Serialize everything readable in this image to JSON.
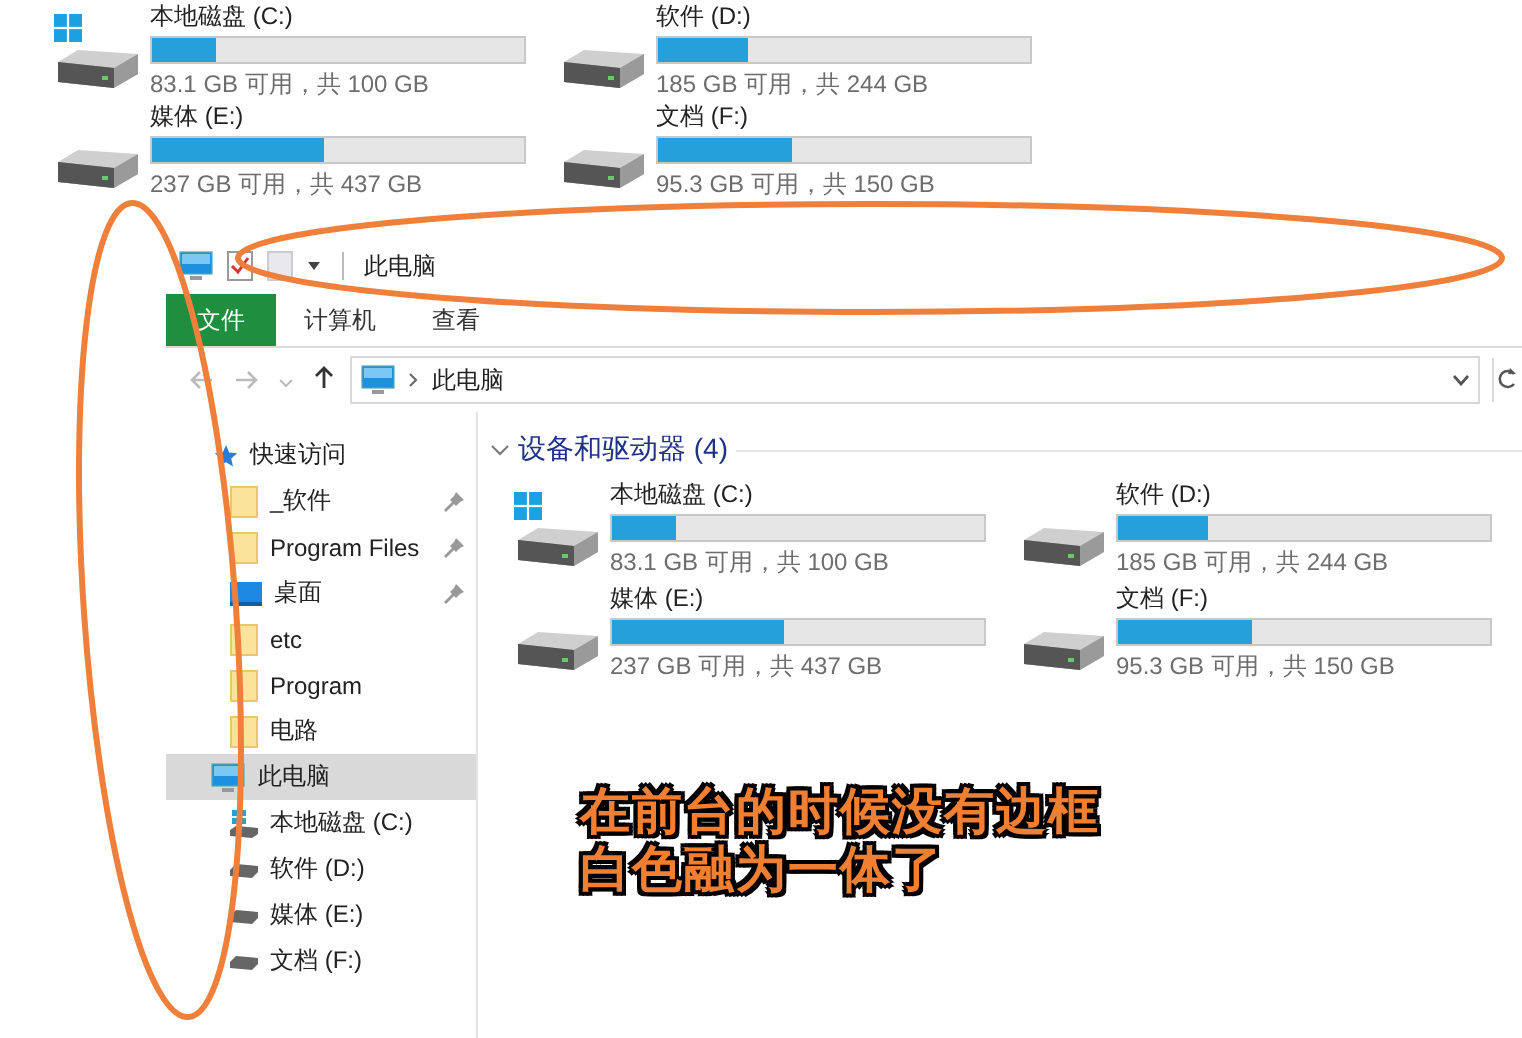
{
  "background_window": {
    "drives": [
      {
        "name": "本地磁盘 (C:)",
        "kind": "system",
        "level": 0.17,
        "free": "83.1 GB 可用，共 100 GB"
      },
      {
        "name": "软件 (D:)",
        "kind": "plain",
        "level": 0.24,
        "free": "185 GB 可用，共 244 GB"
      },
      {
        "name": "媒体 (E:)",
        "kind": "plain",
        "level": 0.46,
        "free": "237 GB 可用，共 437 GB"
      },
      {
        "name": "文档 (F:)",
        "kind": "plain",
        "level": 0.36,
        "free": "95.3 GB 可用，共 150 GB"
      }
    ]
  },
  "window": {
    "title": "此电脑",
    "ribbon_tabs": [
      {
        "label": "文件",
        "selected": true
      },
      {
        "label": "计算机",
        "selected": false
      },
      {
        "label": "查看",
        "selected": false
      }
    ],
    "address": {
      "path": "此电脑"
    },
    "nav_pane": [
      {
        "label": "快速访问",
        "kind": "quick",
        "selected": false,
        "children": [
          {
            "label": "_软件",
            "kind": "folder",
            "pinned": true,
            "selected": false
          },
          {
            "label": "Program Files",
            "kind": "folder",
            "pinned": true,
            "selected": false
          },
          {
            "label": "桌面",
            "kind": "desktop",
            "pinned": true,
            "selected": false
          },
          {
            "label": "etc",
            "kind": "folder",
            "pinned": false,
            "selected": false
          },
          {
            "label": "Program",
            "kind": "folder",
            "pinned": false,
            "selected": false
          },
          {
            "label": "电路",
            "kind": "folder",
            "pinned": false,
            "selected": false
          }
        ]
      },
      {
        "label": "此电脑",
        "kind": "pc",
        "selected": true,
        "children": [
          {
            "label": "本地磁盘 (C:)",
            "kind": "system",
            "pinned": false,
            "selected": false
          },
          {
            "label": "软件 (D:)",
            "kind": "drive",
            "pinned": false,
            "selected": false
          },
          {
            "label": "媒体 (E:)",
            "kind": "drive",
            "pinned": false,
            "selected": false
          },
          {
            "label": "文档 (F:)",
            "kind": "drive",
            "pinned": false,
            "selected": false
          }
        ]
      }
    ],
    "content": {
      "group": "设备和驱动器 (4)",
      "expanded": true,
      "drives": [
        {
          "name": "本地磁盘 (C:)",
          "kind": "system",
          "level": 0.17,
          "free": "83.1 GB 可用，共 100 GB"
        },
        {
          "name": "软件 (D:)",
          "kind": "plain",
          "level": 0.24,
          "free": "185 GB 可用，共 244 GB"
        },
        {
          "name": "媒体 (E:)",
          "kind": "plain",
          "level": 0.46,
          "free": "237 GB 可用，共 437 GB"
        },
        {
          "name": "文档 (F:)",
          "kind": "plain",
          "level": 0.36,
          "free": "95.3 GB 可用，共 150 GB"
        }
      ]
    }
  },
  "annotation": {
    "caption_lines": [
      "在前台的时候没有边框",
      "白色融为一体了"
    ]
  }
}
